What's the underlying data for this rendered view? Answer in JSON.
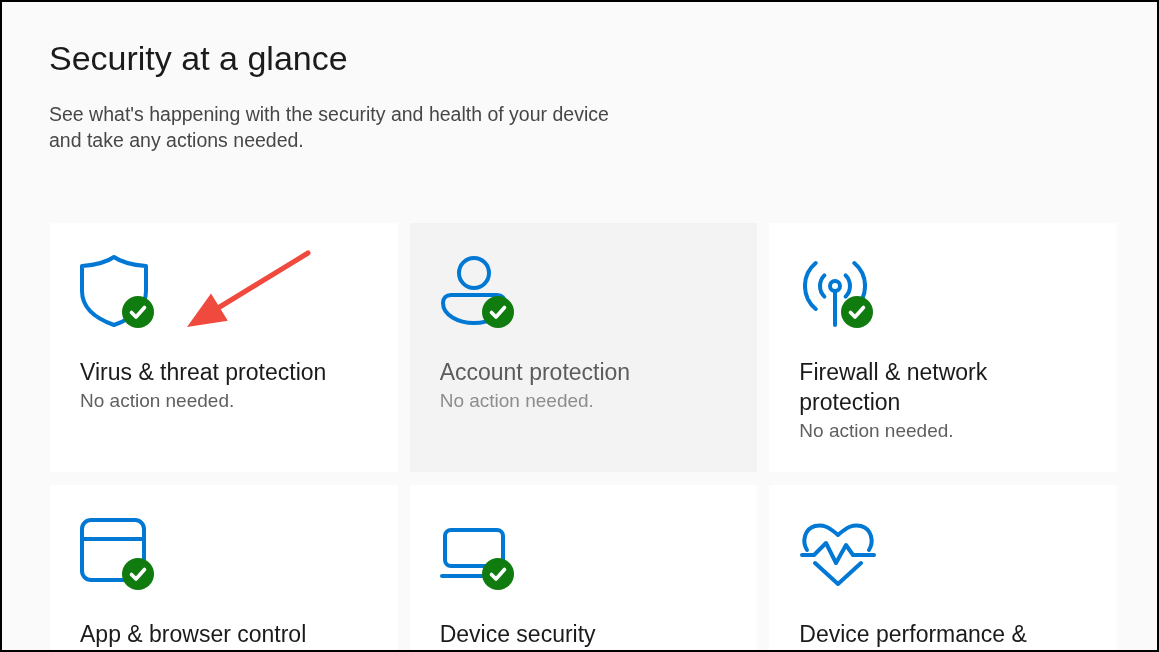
{
  "page": {
    "title": "Security at a glance",
    "description": "See what's happening with the security and health of your device and take any actions needed."
  },
  "cards": [
    {
      "kind": "shield",
      "title": "Virus & threat protection",
      "status": "No action needed.",
      "check_badge": true,
      "hovered": false
    },
    {
      "kind": "person",
      "title": "Account protection",
      "status": "No action needed.",
      "check_badge": true,
      "hovered": true
    },
    {
      "kind": "antenna",
      "title": "Firewall & network protection",
      "status": "No action needed.",
      "check_badge": true,
      "hovered": false
    },
    {
      "kind": "window",
      "title": "App & browser control",
      "check_badge": true,
      "hovered": false
    },
    {
      "kind": "laptop",
      "title": "Device security",
      "check_badge": true,
      "hovered": false
    },
    {
      "kind": "heart",
      "title": "Device performance &",
      "check_badge": false,
      "hovered": false
    }
  ]
}
